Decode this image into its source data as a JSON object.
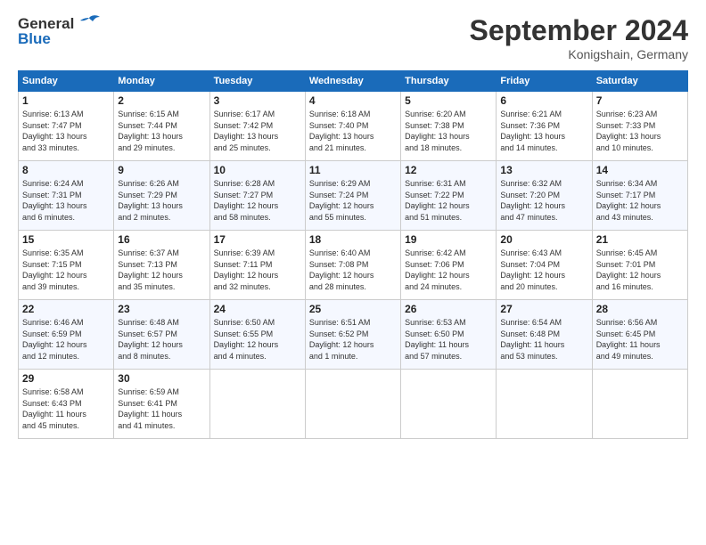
{
  "header": {
    "logo_line1": "General",
    "logo_line2": "Blue",
    "month": "September 2024",
    "location": "Konigshain, Germany"
  },
  "weekdays": [
    "Sunday",
    "Monday",
    "Tuesday",
    "Wednesday",
    "Thursday",
    "Friday",
    "Saturday"
  ],
  "weeks": [
    [
      {
        "day": "1",
        "detail": "Sunrise: 6:13 AM\nSunset: 7:47 PM\nDaylight: 13 hours\nand 33 minutes."
      },
      {
        "day": "2",
        "detail": "Sunrise: 6:15 AM\nSunset: 7:44 PM\nDaylight: 13 hours\nand 29 minutes."
      },
      {
        "day": "3",
        "detail": "Sunrise: 6:17 AM\nSunset: 7:42 PM\nDaylight: 13 hours\nand 25 minutes."
      },
      {
        "day": "4",
        "detail": "Sunrise: 6:18 AM\nSunset: 7:40 PM\nDaylight: 13 hours\nand 21 minutes."
      },
      {
        "day": "5",
        "detail": "Sunrise: 6:20 AM\nSunset: 7:38 PM\nDaylight: 13 hours\nand 18 minutes."
      },
      {
        "day": "6",
        "detail": "Sunrise: 6:21 AM\nSunset: 7:36 PM\nDaylight: 13 hours\nand 14 minutes."
      },
      {
        "day": "7",
        "detail": "Sunrise: 6:23 AM\nSunset: 7:33 PM\nDaylight: 13 hours\nand 10 minutes."
      }
    ],
    [
      {
        "day": "8",
        "detail": "Sunrise: 6:24 AM\nSunset: 7:31 PM\nDaylight: 13 hours\nand 6 minutes."
      },
      {
        "day": "9",
        "detail": "Sunrise: 6:26 AM\nSunset: 7:29 PM\nDaylight: 13 hours\nand 2 minutes."
      },
      {
        "day": "10",
        "detail": "Sunrise: 6:28 AM\nSunset: 7:27 PM\nDaylight: 12 hours\nand 58 minutes."
      },
      {
        "day": "11",
        "detail": "Sunrise: 6:29 AM\nSunset: 7:24 PM\nDaylight: 12 hours\nand 55 minutes."
      },
      {
        "day": "12",
        "detail": "Sunrise: 6:31 AM\nSunset: 7:22 PM\nDaylight: 12 hours\nand 51 minutes."
      },
      {
        "day": "13",
        "detail": "Sunrise: 6:32 AM\nSunset: 7:20 PM\nDaylight: 12 hours\nand 47 minutes."
      },
      {
        "day": "14",
        "detail": "Sunrise: 6:34 AM\nSunset: 7:17 PM\nDaylight: 12 hours\nand 43 minutes."
      }
    ],
    [
      {
        "day": "15",
        "detail": "Sunrise: 6:35 AM\nSunset: 7:15 PM\nDaylight: 12 hours\nand 39 minutes."
      },
      {
        "day": "16",
        "detail": "Sunrise: 6:37 AM\nSunset: 7:13 PM\nDaylight: 12 hours\nand 35 minutes."
      },
      {
        "day": "17",
        "detail": "Sunrise: 6:39 AM\nSunset: 7:11 PM\nDaylight: 12 hours\nand 32 minutes."
      },
      {
        "day": "18",
        "detail": "Sunrise: 6:40 AM\nSunset: 7:08 PM\nDaylight: 12 hours\nand 28 minutes."
      },
      {
        "day": "19",
        "detail": "Sunrise: 6:42 AM\nSunset: 7:06 PM\nDaylight: 12 hours\nand 24 minutes."
      },
      {
        "day": "20",
        "detail": "Sunrise: 6:43 AM\nSunset: 7:04 PM\nDaylight: 12 hours\nand 20 minutes."
      },
      {
        "day": "21",
        "detail": "Sunrise: 6:45 AM\nSunset: 7:01 PM\nDaylight: 12 hours\nand 16 minutes."
      }
    ],
    [
      {
        "day": "22",
        "detail": "Sunrise: 6:46 AM\nSunset: 6:59 PM\nDaylight: 12 hours\nand 12 minutes."
      },
      {
        "day": "23",
        "detail": "Sunrise: 6:48 AM\nSunset: 6:57 PM\nDaylight: 12 hours\nand 8 minutes."
      },
      {
        "day": "24",
        "detail": "Sunrise: 6:50 AM\nSunset: 6:55 PM\nDaylight: 12 hours\nand 4 minutes."
      },
      {
        "day": "25",
        "detail": "Sunrise: 6:51 AM\nSunset: 6:52 PM\nDaylight: 12 hours\nand 1 minute."
      },
      {
        "day": "26",
        "detail": "Sunrise: 6:53 AM\nSunset: 6:50 PM\nDaylight: 11 hours\nand 57 minutes."
      },
      {
        "day": "27",
        "detail": "Sunrise: 6:54 AM\nSunset: 6:48 PM\nDaylight: 11 hours\nand 53 minutes."
      },
      {
        "day": "28",
        "detail": "Sunrise: 6:56 AM\nSunset: 6:45 PM\nDaylight: 11 hours\nand 49 minutes."
      }
    ],
    [
      {
        "day": "29",
        "detail": "Sunrise: 6:58 AM\nSunset: 6:43 PM\nDaylight: 11 hours\nand 45 minutes."
      },
      {
        "day": "30",
        "detail": "Sunrise: 6:59 AM\nSunset: 6:41 PM\nDaylight: 11 hours\nand 41 minutes."
      },
      {
        "day": "",
        "detail": ""
      },
      {
        "day": "",
        "detail": ""
      },
      {
        "day": "",
        "detail": ""
      },
      {
        "day": "",
        "detail": ""
      },
      {
        "day": "",
        "detail": ""
      }
    ]
  ]
}
